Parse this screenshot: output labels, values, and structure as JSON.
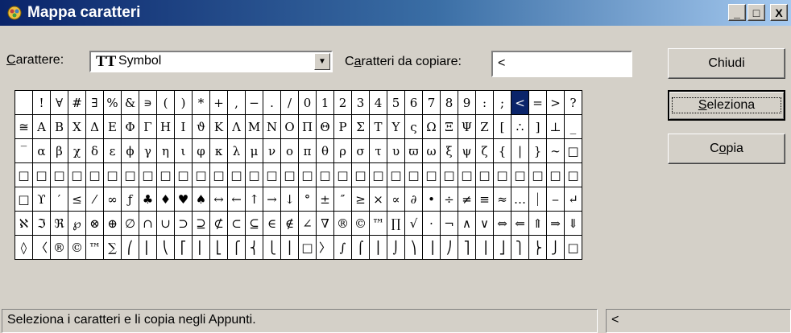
{
  "window": {
    "title": "Mappa caratteri",
    "icon": "character-map-icon",
    "controls": {
      "minimize": "_",
      "maximize": "□",
      "close": "X"
    }
  },
  "font_picker": {
    "label_mnemonic": "C",
    "label_rest": "arattere:",
    "font_type_icon": "TT",
    "selected_font": "Symbol",
    "dropdown_icon": "▼"
  },
  "copy_field": {
    "label_pre": "C",
    "label_mnemonic": "a",
    "label_rest": "ratteri da copiare:",
    "value": "<"
  },
  "buttons": {
    "close": {
      "label": "Chiudi"
    },
    "select": {
      "label_mnemonic": "S",
      "label_rest": "eleziona"
    },
    "copy": {
      "label_pre": "C",
      "label_mnemonic": "o",
      "label_rest": "pia"
    }
  },
  "char_grid": {
    "columns": 32,
    "selected_char": "<",
    "rows": [
      [
        " ",
        "!",
        "∀",
        "#",
        "∃",
        "%",
        "&",
        "∍",
        "(",
        ")",
        "*",
        "+",
        ",",
        "−",
        ".",
        "/",
        "0",
        "1",
        "2",
        "3",
        "4",
        "5",
        "6",
        "7",
        "8",
        "9",
        ":",
        ";",
        "<",
        "=",
        ">",
        "?"
      ],
      [
        "≅",
        "Α",
        "Β",
        "Χ",
        "Δ",
        "Ε",
        "Φ",
        "Γ",
        "Η",
        "Ι",
        "ϑ",
        "Κ",
        "Λ",
        "Μ",
        "Ν",
        "Ο",
        "Π",
        "Θ",
        "Ρ",
        "Σ",
        "Τ",
        "Υ",
        "ς",
        "Ω",
        "Ξ",
        "Ψ",
        "Ζ",
        "[",
        "∴",
        "]",
        "⊥",
        "_"
      ],
      [
        "‾",
        "α",
        "β",
        "χ",
        "δ",
        "ε",
        "ϕ",
        "γ",
        "η",
        "ι",
        "φ",
        "κ",
        "λ",
        "μ",
        "ν",
        "ο",
        "π",
        "θ",
        "ρ",
        "σ",
        "τ",
        "υ",
        "ϖ",
        "ω",
        "ξ",
        "ψ",
        "ζ",
        "{",
        "|",
        "}",
        "∼",
        "□"
      ],
      [
        "□",
        "□",
        "□",
        "□",
        "□",
        "□",
        "□",
        "□",
        "□",
        "□",
        "□",
        "□",
        "□",
        "□",
        "□",
        "□",
        "□",
        "□",
        "□",
        "□",
        "□",
        "□",
        "□",
        "□",
        "□",
        "□",
        "□",
        "□",
        "□",
        "□",
        "□",
        "□"
      ],
      [
        "□",
        "ϒ",
        "′",
        "≤",
        "⁄",
        "∞",
        "ƒ",
        "♣",
        "♦",
        "♥",
        "♠",
        "↔",
        "←",
        "↑",
        "→",
        "↓",
        "°",
        "±",
        "″",
        "≥",
        "×",
        "∝",
        "∂",
        "•",
        "÷",
        "≠",
        "≡",
        "≈",
        "…",
        "⏐",
        "⎯",
        "↵"
      ],
      [
        "ℵ",
        "ℑ",
        "ℜ",
        "℘",
        "⊗",
        "⊕",
        "∅",
        "∩",
        "∪",
        "⊃",
        "⊇",
        "⊄",
        "⊂",
        "⊆",
        "∈",
        "∉",
        "∠",
        "∇",
        "®",
        "©",
        "™",
        "∏",
        "√",
        "⋅",
        "¬",
        "∧",
        "∨",
        "⇔",
        "⇐",
        "⇑",
        "⇒",
        "⇓"
      ],
      [
        "◊",
        "〈",
        "®",
        "©",
        "™",
        "∑",
        "⎛",
        "⎜",
        "⎝",
        "⎡",
        "⎢",
        "⎣",
        "⎧",
        "⎨",
        "⎩",
        "⎪",
        "□",
        "〉",
        "∫",
        "⌠",
        "⎮",
        "⌡",
        "⎞",
        "⎟",
        "⎠",
        "⎤",
        "⎥",
        "⎦",
        "⎫",
        "⎬",
        "⎭",
        "□"
      ]
    ]
  },
  "status_bar": {
    "message": "Seleziona i caratteri e li copia negli Appunti.",
    "key_hint": "<"
  }
}
